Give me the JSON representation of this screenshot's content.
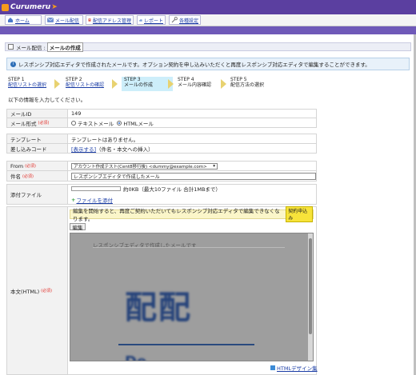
{
  "app": {
    "logo_text": "Curumeru"
  },
  "nav": [
    {
      "label": "ホーム",
      "icon": "home-icon"
    },
    {
      "label": "メール配信",
      "icon": "mail-icon"
    },
    {
      "label": "配信アドレス管理",
      "icon": "address-book-icon"
    },
    {
      "label": "レポート",
      "icon": "chart-icon"
    },
    {
      "label": "各種設定",
      "icon": "wrench-icon"
    }
  ],
  "breadcrumb": {
    "section": "メール配信 :",
    "page": "メールの作成"
  },
  "info_text": "レスポンシブ対応エディタで作成されたメールです。オプション契約を申し込みいただくと再度レスポンシブ対応エディタで編集することができます。",
  "steps": [
    {
      "num": "STEP 1",
      "label": "配信リストの選択",
      "link": true
    },
    {
      "num": "STEP 2",
      "label": "配信リストの確認",
      "link": true
    },
    {
      "num": "STEP 3",
      "label": "メールの作成",
      "link": false
    },
    {
      "num": "STEP 4",
      "label": "メール内容確認",
      "link": false
    },
    {
      "num": "STEP 5",
      "label": "配信方法の選択",
      "link": false
    }
  ],
  "prompt": "以下の情報を入力してください。",
  "required_badge": "(必須)",
  "fields": {
    "mail_id": {
      "label": "メールID",
      "value": "149"
    },
    "mail_format": {
      "label": "メール形式",
      "opt_text": "テキストメール",
      "opt_html": "HTMLメール",
      "selected": "html"
    },
    "template": {
      "label": "テンプレート",
      "value": "テンプレートはありません。"
    },
    "insert_code": {
      "label": "差し込みコード",
      "link": "[表示する]",
      "suffix": "（件名・本文への挿入）"
    },
    "from": {
      "label": "From",
      "value": "アカウント作成テスト(Cent8移行後) <dummy@example.com>"
    },
    "subject": {
      "label": "件名",
      "value": "レスポンシブエディタで作成したメール"
    },
    "attachment": {
      "label": "添付ファイル",
      "size_text": "約0KB（最大10ファイル 合計1MBまで）",
      "add_link": "ファイルを添付"
    },
    "body": {
      "label": "本文(HTML)"
    }
  },
  "warning": {
    "text": "編集を開始すると、再度ご契約いただいてもレスポンシブ対応エディタで編集できなくなります。",
    "button": "契約申込み"
  },
  "edit_button": "編集",
  "preview": {
    "heading": "レスポンシブエディタで作成したメールです",
    "big_text": "配配",
    "sub_text": "De..."
  },
  "html_design_link": "HTMLデザイン集",
  "colors": {
    "header": "#5b3fa0",
    "accent_orange": "#f59b1b",
    "link": "#1a3ca5",
    "required": "#e2312b"
  }
}
